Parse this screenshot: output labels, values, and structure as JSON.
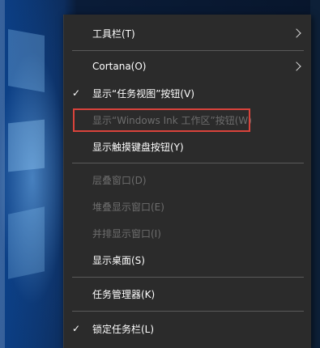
{
  "menu": {
    "items": [
      {
        "label": "工具栏(T)",
        "submenu": true,
        "enabled": true
      },
      {
        "label": "Cortana(O)",
        "submenu": true,
        "enabled": true
      },
      {
        "label": "显示“任务视图”按钮(V)",
        "checked": true,
        "enabled": true
      },
      {
        "label": "显示“Windows Ink 工作区”按钮(W)",
        "enabled": false,
        "highlighted": true
      },
      {
        "label": "显示触摸键盘按钮(Y)",
        "enabled": true
      },
      {
        "label": "层叠窗口(D)",
        "enabled": false
      },
      {
        "label": "堆叠显示窗口(E)",
        "enabled": false
      },
      {
        "label": "并排显示窗口(I)",
        "enabled": false
      },
      {
        "label": "显示桌面(S)",
        "enabled": true
      },
      {
        "label": "任务管理器(K)",
        "enabled": true
      },
      {
        "label": "锁定任务栏(L)",
        "checked": true,
        "enabled": true
      }
    ],
    "check_glyph": "✓",
    "highlight_color": "#d9433b"
  }
}
